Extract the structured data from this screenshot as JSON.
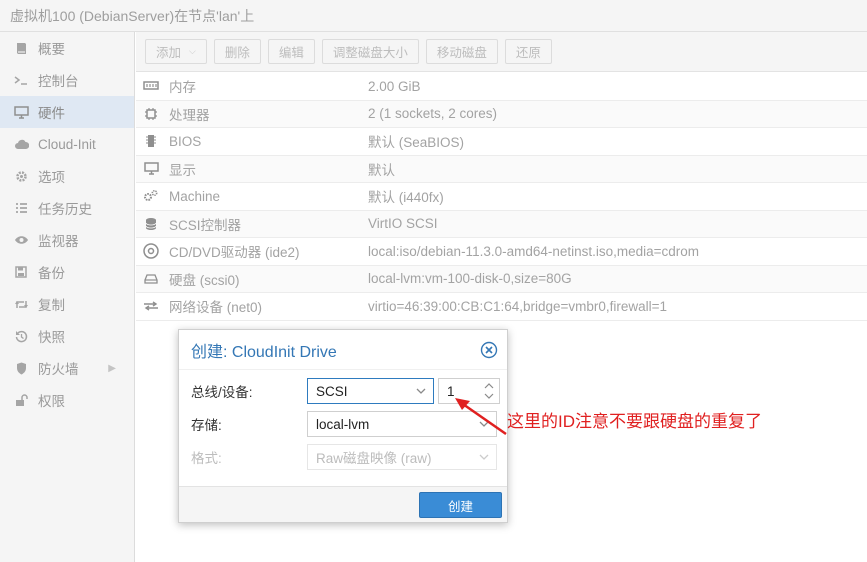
{
  "window": {
    "title": "虚拟机100 (DebianServer)在节点'lan'上"
  },
  "sidebar": {
    "items": [
      {
        "label": "概要",
        "icon": "book-icon"
      },
      {
        "label": "控制台",
        "icon": "terminal-icon"
      },
      {
        "label": "硬件",
        "icon": "monitor-icon",
        "active": true
      },
      {
        "label": "Cloud-Init",
        "icon": "cloud-icon"
      },
      {
        "label": "选项",
        "icon": "gear-icon"
      },
      {
        "label": "任务历史",
        "icon": "list-icon"
      },
      {
        "label": "监视器",
        "icon": "eye-icon"
      },
      {
        "label": "备份",
        "icon": "floppy-icon"
      },
      {
        "label": "复制",
        "icon": "retweet-icon"
      },
      {
        "label": "快照",
        "icon": "history-icon"
      },
      {
        "label": "防火墙",
        "icon": "shield-icon",
        "has_submenu": true
      },
      {
        "label": "权限",
        "icon": "unlock-icon"
      }
    ]
  },
  "toolbar": {
    "add": "添加",
    "remove": "删除",
    "edit": "编辑",
    "resize": "调整磁盘大小",
    "move": "移动磁盘",
    "revert": "还原"
  },
  "hardware": [
    {
      "name": "内存",
      "value": "2.00 GiB",
      "icon": "memory-icon"
    },
    {
      "name": "处理器",
      "value": "2 (1 sockets, 2 cores)",
      "icon": "cpu-icon"
    },
    {
      "name": "BIOS",
      "value": "默认 (SeaBIOS)",
      "icon": "bios-icon"
    },
    {
      "name": "显示",
      "value": "默认",
      "icon": "display-icon"
    },
    {
      "name": "Machine",
      "value": "默认 (i440fx)",
      "icon": "cogs-icon"
    },
    {
      "name": "SCSI控制器",
      "value": "VirtIO SCSI",
      "icon": "database-icon"
    },
    {
      "name": "CD/DVD驱动器 (ide2)",
      "value": "local:iso/debian-11.3.0-amd64-netinst.iso,media=cdrom",
      "icon": "cdrom-icon"
    },
    {
      "name": "硬盘 (scsi0)",
      "value": "local-lvm:vm-100-disk-0,size=80G",
      "icon": "hdd-icon"
    },
    {
      "name": "网络设备 (net0)",
      "value": "virtio=46:39:00:CB:C1:64,bridge=vmbr0,firewall=1",
      "icon": "network-icon"
    }
  ],
  "dialog": {
    "title": "创建: CloudInit Drive",
    "bus_label": "总线/设备:",
    "bus_value": "SCSI",
    "device_id": "1",
    "storage_label": "存储:",
    "storage_value": "local-lvm",
    "format_label": "格式:",
    "format_value": "Raw磁盘映像 (raw)",
    "create_button": "创建"
  },
  "annotation": {
    "text": "这里的ID注意不要跟硬盘的重复了",
    "color": "#e02020"
  },
  "colors": {
    "accent": "#3477b5",
    "button": "#3a8cd6",
    "active_nav": "#dfe8f3"
  }
}
